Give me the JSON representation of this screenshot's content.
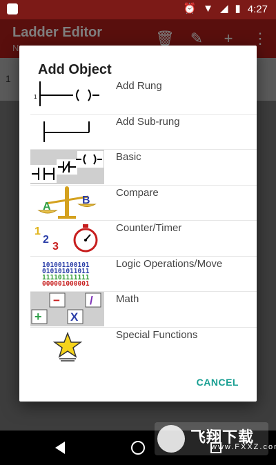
{
  "status_bar": {
    "time": "4:27"
  },
  "app_bar": {
    "title": "Ladder Editor",
    "subtitle": "N"
  },
  "editor": {
    "rung_number": "1"
  },
  "dialog": {
    "title": "Add Object",
    "items": [
      {
        "label": "Add Rung",
        "icon": "rung-icon"
      },
      {
        "label": "Add Sub-rung",
        "icon": "sub-rung-icon"
      },
      {
        "label": "Basic",
        "icon": "basic-contacts-icon"
      },
      {
        "label": "Compare",
        "icon": "balance-scale-icon"
      },
      {
        "label": "Counter/Timer",
        "icon": "counter-timer-icon"
      },
      {
        "label": "Logic Operations/Move",
        "icon": "binary-icon"
      },
      {
        "label": "Math",
        "icon": "math-operators-icon"
      },
      {
        "label": "Special Functions",
        "icon": "star-icon"
      }
    ],
    "cancel_label": "CANCEL",
    "rung_thumb_number": "1",
    "compare_letters": [
      "A",
      "B"
    ],
    "counter_digits": [
      "1",
      "2",
      "3"
    ],
    "binary_lines": [
      "101001100101",
      "010101011011",
      "111101111111",
      "000001000001"
    ],
    "math_ops": [
      "−",
      "/",
      "+",
      "X"
    ]
  },
  "watermark": {
    "text": "飞翔下载",
    "url": "www.FXXZ.com"
  },
  "colors": {
    "accent": "#169e91",
    "app_bar": "#b21f1a",
    "status_bar": "#7c1a17"
  }
}
